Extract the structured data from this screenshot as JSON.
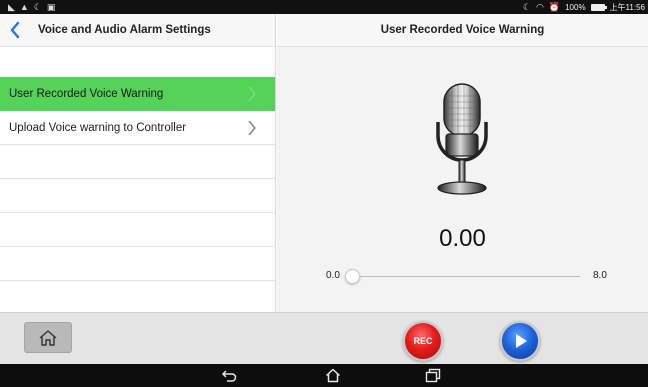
{
  "status_bar": {
    "left_icons": [
      "signal-icon",
      "warning-icon",
      "moon-icon",
      "image-icon"
    ],
    "right_icons": [
      "moon-icon",
      "wifi-icon",
      "alarm-icon"
    ],
    "battery_percent": "100%",
    "time": "上午11:56"
  },
  "left_panel": {
    "title": "Voice and Audio Alarm Settings",
    "items": [
      {
        "label": "User Recorded Voice Warning",
        "active": true
      },
      {
        "label": "Upload Voice warning to Controller",
        "active": false
      }
    ]
  },
  "right_panel": {
    "title": "User Recorded Voice Warning",
    "timer": "0.00",
    "slider": {
      "min_label": "0.0",
      "max_label": "8.0",
      "value": 0.0,
      "min": 0.0,
      "max": 8.0
    }
  },
  "toolbar": {
    "rec_label": "REC",
    "icons": [
      "home-icon",
      "record-icon",
      "play-icon"
    ]
  },
  "nav_bar": {
    "icons": [
      "back-icon",
      "home-icon",
      "recents-icon"
    ]
  },
  "colors": {
    "accent_green": "#55d257",
    "back_blue": "#1e73e8",
    "rec_red": "#e41c1c",
    "play_blue": "#1a5fd6"
  }
}
